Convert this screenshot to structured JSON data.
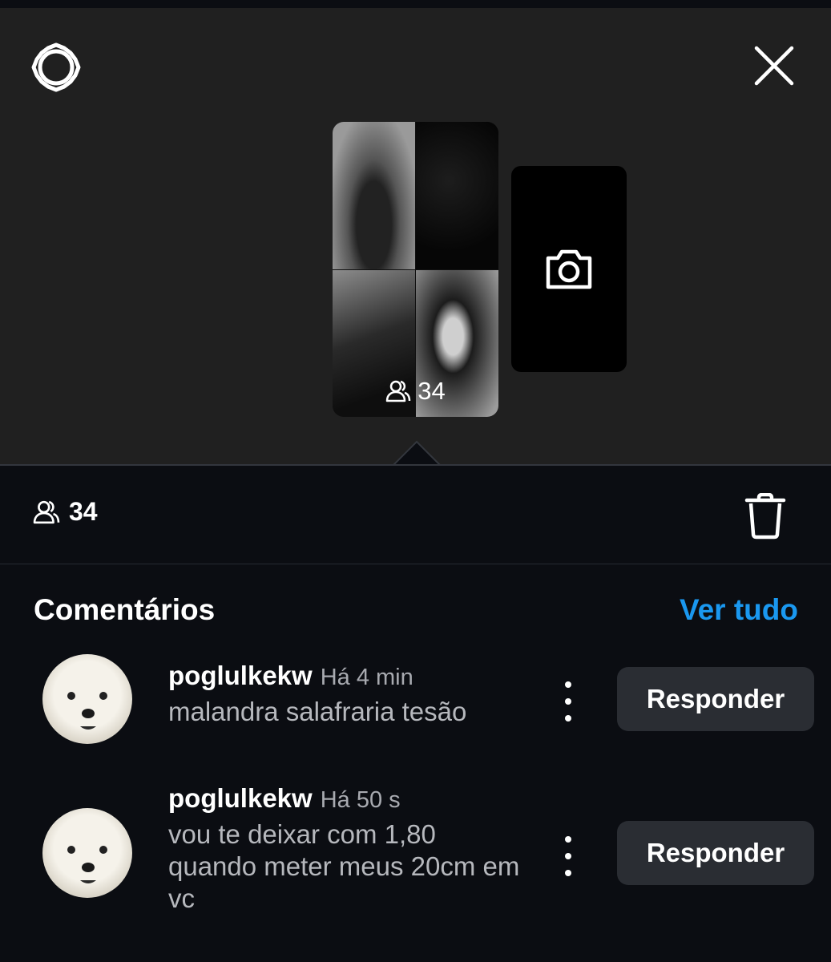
{
  "story": {
    "view_count": "34"
  },
  "stats": {
    "view_count": "34"
  },
  "comments_section": {
    "title": "Comentários",
    "see_all": "Ver tudo"
  },
  "comments": [
    {
      "username": "poglulkekw",
      "time": "Há 4 min",
      "text": "malandra salafraria tesão",
      "reply_label": "Responder"
    },
    {
      "username": "poglulkekw",
      "time": "Há 50 s",
      "text": "vou te deixar com 1,80 quando meter meus 20cm em vc",
      "reply_label": "Responder"
    }
  ],
  "icons": [
    "gear-icon",
    "close-icon",
    "camera-icon",
    "viewers-icon",
    "trash-icon",
    "more-icon"
  ],
  "colors": {
    "top_background": "#202020",
    "panel_background": "#0b0d12",
    "accent": "#1a98f0",
    "reply_button": "#2a2d33"
  }
}
